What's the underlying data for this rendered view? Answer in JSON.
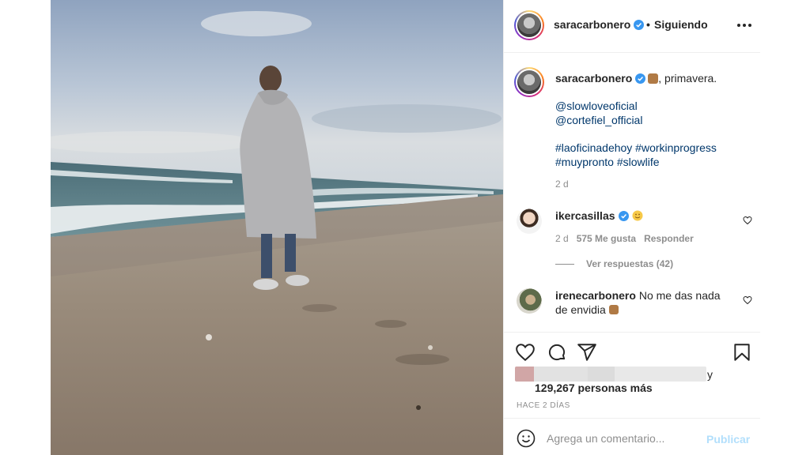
{
  "post": {
    "author": "saracarbonero",
    "follow_separator": "•",
    "follow_status": "Siguiendo",
    "caption": {
      "username": "saracarbonero",
      "text": ", primavera.",
      "mentions": [
        "@slowloveoficial",
        "@cortefiel_official"
      ],
      "hashtags_line1": "#laoficinadehoy #workinprogress",
      "hashtags_line2": "#muypronto #slowlife",
      "time": "2 d"
    },
    "comments": [
      {
        "username": "ikercasillas",
        "text": "",
        "time": "2 d",
        "likes": "575 Me gusta",
        "reply": "Responder",
        "view_replies": "Ver respuestas (42)"
      },
      {
        "username": "irenecarbonero",
        "text": "No me das nada",
        "text_line2": "de envidia"
      }
    ],
    "likes_connector": "y",
    "likes_others": "129,267 personas más",
    "age": "HACE 2 DÍAS",
    "comment_placeholder": "Agrega un comentario...",
    "publish_label": "Publicar"
  },
  "colors": {
    "verified": "#3897f0",
    "link": "#00376b",
    "muted": "#8e8e8e",
    "publish_disabled": "#b2dffc"
  },
  "icons": [
    "more-options-icon",
    "verified-icon",
    "heart-icon",
    "comment-icon",
    "share-icon",
    "bookmark-icon",
    "emoji-icon"
  ]
}
